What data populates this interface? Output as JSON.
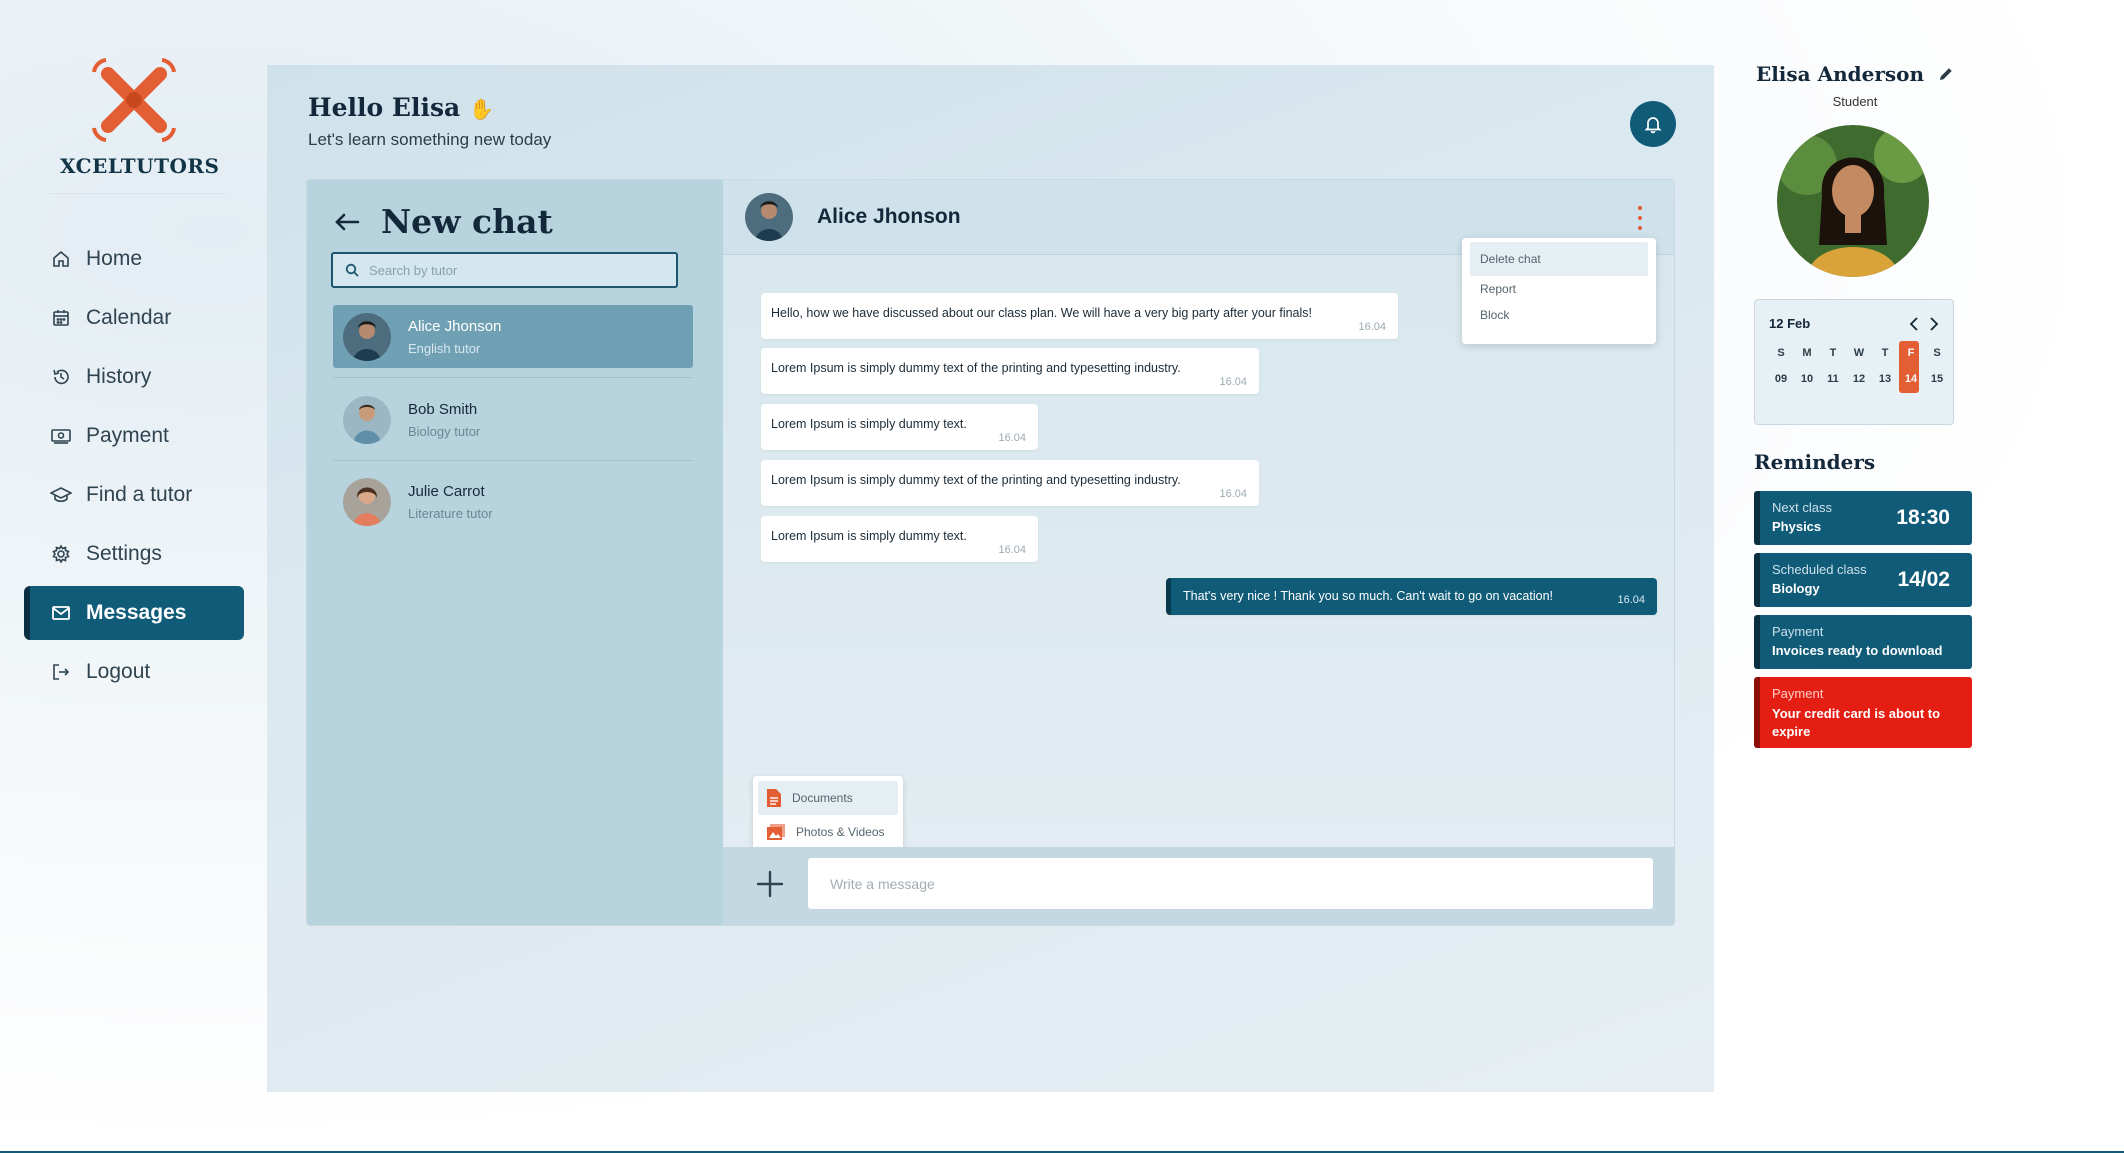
{
  "brand": {
    "name": "XCELTUTORS",
    "accent": "#e45e33",
    "primary": "#0f5b78"
  },
  "nav": {
    "items": [
      {
        "label": "Home",
        "icon": "home-icon"
      },
      {
        "label": "Calendar",
        "icon": "calendar-icon"
      },
      {
        "label": "History",
        "icon": "history-icon"
      },
      {
        "label": "Payment",
        "icon": "payment-icon"
      },
      {
        "label": "Find a tutor",
        "icon": "graduation-cap-icon"
      },
      {
        "label": "Settings",
        "icon": "gear-icon"
      },
      {
        "label": "Messages",
        "icon": "mail-icon",
        "active": true
      },
      {
        "label": "Logout",
        "icon": "logout-icon"
      }
    ]
  },
  "header": {
    "greeting": "Hello Elisa",
    "subtitle": "Let's learn something new today"
  },
  "chat_list": {
    "title": "New chat",
    "search_placeholder": "Search by tutor",
    "tutors": [
      {
        "name": "Alice Jhonson",
        "role": "English tutor",
        "selected": true
      },
      {
        "name": "Bob Smith",
        "role": "Biology tutor"
      },
      {
        "name": "Julie Carrot",
        "role": "Literature tutor"
      }
    ]
  },
  "chat": {
    "contact_name": "Alice Jhonson",
    "menu": [
      "Delete chat",
      "Report",
      "Block"
    ],
    "messages": [
      {
        "text": "Hello, how we have discussed about our class plan. We will have a very big party after your finals!",
        "time": "16.04",
        "direction": "in"
      },
      {
        "text": "Lorem Ipsum is simply dummy text of the printing and typesetting industry.",
        "time": "16.04",
        "direction": "in"
      },
      {
        "text": "Lorem Ipsum is simply dummy text.",
        "time": "16.04",
        "direction": "in"
      },
      {
        "text": "Lorem Ipsum is simply dummy text of the printing and typesetting industry.",
        "time": "16.04",
        "direction": "in"
      },
      {
        "text": "Lorem Ipsum is simply dummy text.",
        "time": "16.04",
        "direction": "in"
      },
      {
        "text": "That's very nice ! Thank you so much. Can't wait to go on vacation!",
        "time": "16.04",
        "direction": "out"
      }
    ],
    "attach_options": [
      "Documents",
      "Photos & Videos"
    ],
    "input_placeholder": "Write a message"
  },
  "profile": {
    "name": "Elisa Anderson",
    "role": "Student"
  },
  "calendar": {
    "label": "12 Feb",
    "weekdays": [
      "S",
      "M",
      "T",
      "W",
      "T",
      "F",
      "S"
    ],
    "days": [
      "09",
      "10",
      "11",
      "12",
      "13",
      "14",
      "15"
    ],
    "selected_index": 5
  },
  "reminders": {
    "title": "Reminders",
    "items": [
      {
        "kind": "Next class",
        "value": "Physics",
        "big": "18:30"
      },
      {
        "kind": "Scheduled class",
        "value": "Biology",
        "big": "14/02"
      },
      {
        "kind": "Payment",
        "value": "Invoices ready to download",
        "big": ""
      },
      {
        "kind": "Payment",
        "value": "Your credit card is about to expire",
        "big": "",
        "alert": true
      }
    ]
  }
}
